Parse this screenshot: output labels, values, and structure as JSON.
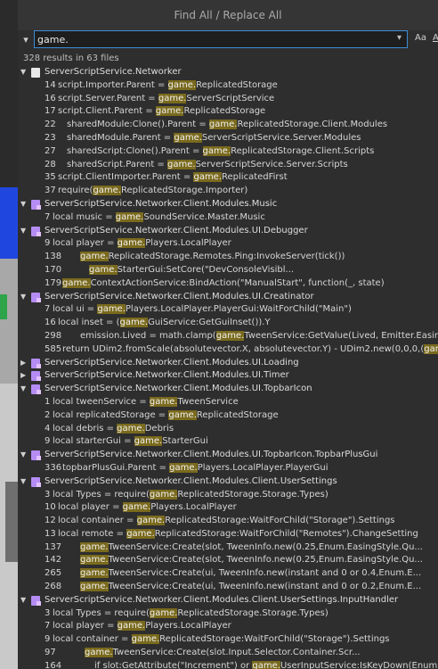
{
  "window": {
    "title": "Find All / Replace All"
  },
  "search": {
    "value": "game.",
    "case_label": "Aa",
    "word_label": "A"
  },
  "summary": "328 results in 63 files",
  "colors": {
    "highlight": "#7a6a1d",
    "focus_border": "#3d8bd6",
    "module_icon": "#b58cf3"
  },
  "results": [
    {
      "file": "ServerScriptService.Networker",
      "icon": "script-icon",
      "lines": [
        {
          "n": "14",
          "pre": "script.Importer.Parent = ",
          "hl": "game.",
          "post": "ReplicatedStorage",
          "indent": 0
        },
        {
          "n": "16",
          "pre": "script.Server.Parent = ",
          "hl": "game.",
          "post": "ServerScriptService",
          "indent": 0
        },
        {
          "n": "17",
          "pre": "script.Client.Parent = ",
          "hl": "game.",
          "post": "ReplicatedStorage",
          "indent": 0
        },
        {
          "n": "22",
          "pre": "sharedModule:Clone().Parent = ",
          "hl": "game.",
          "post": "ReplicatedStorage.Client.Modules",
          "indent": 1
        },
        {
          "n": "23",
          "pre": "sharedModule.Parent = ",
          "hl": "game.",
          "post": "ServerScriptService.Server.Modules",
          "indent": 1
        },
        {
          "n": "27",
          "pre": "sharedScript:Clone().Parent = ",
          "hl": "game.",
          "post": "ReplicatedStorage.Client.Scripts",
          "indent": 1
        },
        {
          "n": "28",
          "pre": "sharedScript.Parent = ",
          "hl": "game.",
          "post": "ServerScriptService.Server.Scripts",
          "indent": 1
        },
        {
          "n": "35",
          "pre": "script.ClientImporter.Parent = ",
          "hl": "game.",
          "post": "ReplicatedFirst",
          "indent": 0
        },
        {
          "n": "37",
          "pre": "require(",
          "hl": "game.",
          "post": "ReplicatedStorage.Importer)",
          "indent": 0
        }
      ]
    },
    {
      "file": "ServerScriptService.Networker.Client.Modules.Music",
      "icon": "module-icon",
      "lines": [
        {
          "n": "7",
          "pre": "local music = ",
          "hl": "game.",
          "post": "SoundService.Master.Music",
          "indent": 0
        }
      ]
    },
    {
      "file": "ServerScriptService.Networker.Client.Modules.UI.Debugger",
      "icon": "module-icon",
      "lines": [
        {
          "n": "9",
          "pre": "local player = ",
          "hl": "game.",
          "post": "Players.LocalPlayer",
          "indent": 0
        },
        {
          "n": "138",
          "pre": "",
          "hl": "game.",
          "post": "ReplicatedStorage.Remotes.Ping:InvokeServer(tick())",
          "indent": 2
        },
        {
          "n": "170",
          "pre": "",
          "hl": "game.",
          "post": "StarterGui:SetCore(\"DevConsoleVisibl...",
          "indent": 3
        },
        {
          "n": "179",
          "pre": "",
          "hl": "game.",
          "post": "ContextActionService:BindAction(\"ManualStart\", function(_, state)",
          "indent": 0
        }
      ]
    },
    {
      "file": "ServerScriptService.Networker.Client.Modules.UI.Creatinator",
      "icon": "module-icon",
      "lines": [
        {
          "n": "7",
          "pre": "local ui = ",
          "hl": "game.",
          "post": "Players.LocalPlayer.PlayerGui:WaitForChild(\"Main\")",
          "indent": 0
        },
        {
          "n": "16",
          "pre": "local inset = (",
          "hl": "game.",
          "post": "GuiService:GetGuiInset()).Y",
          "indent": 0
        },
        {
          "n": "298",
          "pre": "emission.Lived = math.clamp(",
          "hl": "game.",
          "post": "TweenService:GetValue(Lived, Emitter.EasingStyle, Emitter.EasingDi",
          "indent": 2
        },
        {
          "n": "585",
          "pre": "return UDim2.fromScale(absolutevector.X, absolutevector.Y) - UDim2.new(0,0,0,(",
          "hl": "game.",
          "post": "GuiService:GetGui",
          "indent": 0
        }
      ]
    },
    {
      "file": "ServerScriptService.Networker.Client.Modules.UI.Loading",
      "icon": "module-icon",
      "collapsed": true,
      "lines": []
    },
    {
      "file": "ServerScriptService.Networker.Client.Modules.UI.Timer",
      "icon": "module-icon",
      "collapsed": true,
      "lines": []
    },
    {
      "file": "ServerScriptService.Networker.Client.Modules.UI.TopbarIcon",
      "icon": "module-icon",
      "lines": [
        {
          "n": "1",
          "pre": "local tweenService = ",
          "hl": "game.",
          "post": "TweenService",
          "indent": 0
        },
        {
          "n": "2",
          "pre": "local replicatedStorage = ",
          "hl": "game.",
          "post": "ReplicatedStorage",
          "indent": 0
        },
        {
          "n": "4",
          "pre": "local debris = ",
          "hl": "game.",
          "post": "Debris",
          "indent": 0
        },
        {
          "n": "9",
          "pre": "local starterGui = ",
          "hl": "game.",
          "post": "StarterGui",
          "indent": 0
        }
      ]
    },
    {
      "file": "ServerScriptService.Networker.Client.Modules.UI.TopbarIcon.TopbarPlusGui",
      "icon": "module-icon",
      "lines": [
        {
          "n": "336",
          "pre": "topbarPlusGui.Parent = ",
          "hl": "game.",
          "post": "Players.LocalPlayer.PlayerGui",
          "indent": 0
        }
      ]
    },
    {
      "file": "ServerScriptService.Networker.Client.Modules.Client.UserSettings",
      "icon": "module-icon",
      "lines": [
        {
          "n": "3",
          "pre": "local Types = require(",
          "hl": "game.",
          "post": "ReplicatedStorage.Storage.Types)",
          "indent": 0
        },
        {
          "n": "10",
          "pre": "local player = ",
          "hl": "game.",
          "post": "Players.LocalPlayer",
          "indent": 0
        },
        {
          "n": "12",
          "pre": "local container = ",
          "hl": "game.",
          "post": "ReplicatedStorage:WaitForChild(\"Storage\").Settings",
          "indent": 0
        },
        {
          "n": "13",
          "pre": "local remote = ",
          "hl": "game.",
          "post": "ReplicatedStorage:WaitForChild(\"Remotes\").ChangeSetting",
          "indent": 0
        },
        {
          "n": "137",
          "pre": "",
          "hl": "game.",
          "post": "TweenService:Create(slot, TweenInfo.new(0.25,Enum.EasingStyle.Qu...",
          "indent": 2
        },
        {
          "n": "142",
          "pre": "",
          "hl": "game.",
          "post": "TweenService:Create(slot, TweenInfo.new(0.25,Enum.EasingStyle.Qu...",
          "indent": 2
        },
        {
          "n": "265",
          "pre": "",
          "hl": "game.",
          "post": "TweenService:Create(ui, TweenInfo.new(instant and 0 or 0.4,Enum.E...",
          "indent": 2
        },
        {
          "n": "268",
          "pre": "",
          "hl": "game.",
          "post": "TweenService:Create(ui, TweenInfo.new(instant and 0 or 0.2,Enum.E...",
          "indent": 2
        }
      ]
    },
    {
      "file": "ServerScriptService.Networker.Client.Modules.Client.UserSettings.InputHandler",
      "icon": "module-icon",
      "lines": [
        {
          "n": "3",
          "pre": "local Types = require(",
          "hl": "game.",
          "post": "ReplicatedStorage.Storage.Types)",
          "indent": 0
        },
        {
          "n": "7",
          "pre": "local player = ",
          "hl": "game.",
          "post": "Players.LocalPlayer",
          "indent": 0
        },
        {
          "n": "9",
          "pre": "local container = ",
          "hl": "game.",
          "post": "ReplicatedStorage:WaitForChild(\"Storage\").Settings",
          "indent": 0
        },
        {
          "n": "97",
          "pre": "",
          "hl": "game.",
          "post": "TweenService:Create(slot.Input.Selector.Container.Scr...",
          "indent": 3
        },
        {
          "n": "164",
          "pre": "if slot:GetAttribute(\"Increment\") or ",
          "hl": "game.",
          "post": "UserInputService:IsKeyDown(Enum.KeyCode.LeftCo...",
          "indent": 4
        }
      ]
    }
  ]
}
